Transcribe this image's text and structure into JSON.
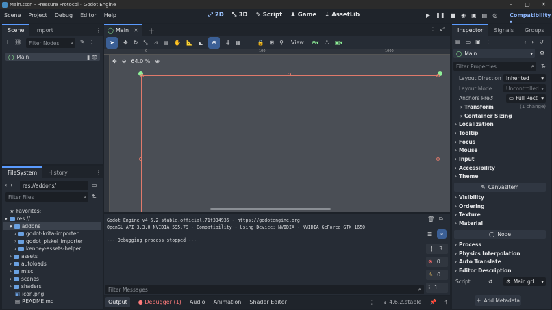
{
  "window": {
    "title": "Main.tscn - Pressure Protocol - Godot Engine",
    "controls": [
      "–",
      "▢",
      "✕"
    ]
  },
  "menubar": {
    "items": [
      "Scene",
      "Project",
      "Debug",
      "Editor",
      "Help"
    ],
    "workspaces": [
      {
        "label": "2D",
        "icon": "2d-icon"
      },
      {
        "label": "3D",
        "icon": "3d-icon"
      },
      {
        "label": "Script",
        "icon": "script-icon"
      },
      {
        "label": "Game",
        "icon": "game-icon"
      },
      {
        "label": "AssetLib",
        "icon": "assetlib-icon"
      }
    ],
    "renderer": "Compatibility"
  },
  "scene_dock": {
    "tabs": [
      "Scene",
      "Import"
    ],
    "filter_placeholder": "Filter Nodes",
    "root_node": "Main"
  },
  "filesystem": {
    "tabs": [
      "FileSystem",
      "History"
    ],
    "path": "res://addons/",
    "filter_placeholder": "Filter Files",
    "favorites": "Favorites:",
    "root": "res://",
    "items": [
      {
        "name": "addons",
        "level": 1,
        "expanded": true,
        "selected": true
      },
      {
        "name": "godot-krita-importer",
        "level": 2
      },
      {
        "name": "godot_piskel_importer",
        "level": 2
      },
      {
        "name": "kenney-assets-helper",
        "level": 2
      },
      {
        "name": "assets",
        "level": 1
      },
      {
        "name": "autoloads",
        "level": 1
      },
      {
        "name": "misc",
        "level": 1
      },
      {
        "name": "scenes",
        "level": 1
      },
      {
        "name": "shaders",
        "level": 1
      },
      {
        "name": "icon.png",
        "level": 1,
        "file": true
      },
      {
        "name": "README.md",
        "level": 1,
        "file": true
      }
    ]
  },
  "editor": {
    "scene_tab": "Main",
    "zoom": "64.0 %",
    "view_menu": "View",
    "ruler": [
      "0",
      "100",
      "1000"
    ]
  },
  "output": {
    "lines": [
      "Godot Engine v4.6.2.stable.official.71f334935 - https://godotengine.org",
      "OpenGL API 3.3.0 NVIDIA 595.79 - Compatibility - Using Device: NVIDIA - NVIDIA GeForce GTX 1650",
      "",
      "--- Debugging process stopped ---"
    ],
    "filter_placeholder": "Filter Messages",
    "counts": [
      "3",
      "0",
      "0",
      "1"
    ]
  },
  "bottom_tabs": {
    "items": [
      "Output",
      "Debugger (1)",
      "Audio",
      "Animation",
      "Shader Editor"
    ],
    "version": "4.6.2.stable"
  },
  "inspector": {
    "tabs": [
      "Inspector",
      "Signals",
      "Groups"
    ],
    "node": "Main",
    "filter_placeholder": "Filter Properties",
    "layout_direction_label": "Layout Direction",
    "layout_direction_value": "Inherited",
    "layout_mode_label": "Layout Mode",
    "layout_mode_value": "Uncontrolled",
    "anchors_label": "Anchors Pre",
    "anchors_value": "Full Rect",
    "transform_label": "Transform",
    "transform_note": "(1 change)",
    "container_sizing": "Container Sizing",
    "groups_a": [
      "Localization",
      "Tooltip",
      "Focus",
      "Mouse",
      "Input",
      "Accessibility",
      "Theme"
    ],
    "canvasitem": "CanvasItem",
    "groups_b": [
      "Visibility",
      "Ordering",
      "Texture",
      "Material"
    ],
    "node_section": "Node",
    "groups_c": [
      "Process",
      "Physics Interpolation",
      "Auto Translate",
      "Editor Description"
    ],
    "script_label": "Script",
    "script_value": "Main.gd",
    "add_metadata": "Add Metadata"
  },
  "colors": {
    "accent": "#5a9bff",
    "node_green": "#8eef97",
    "viewport_border": "#e07a6b"
  }
}
